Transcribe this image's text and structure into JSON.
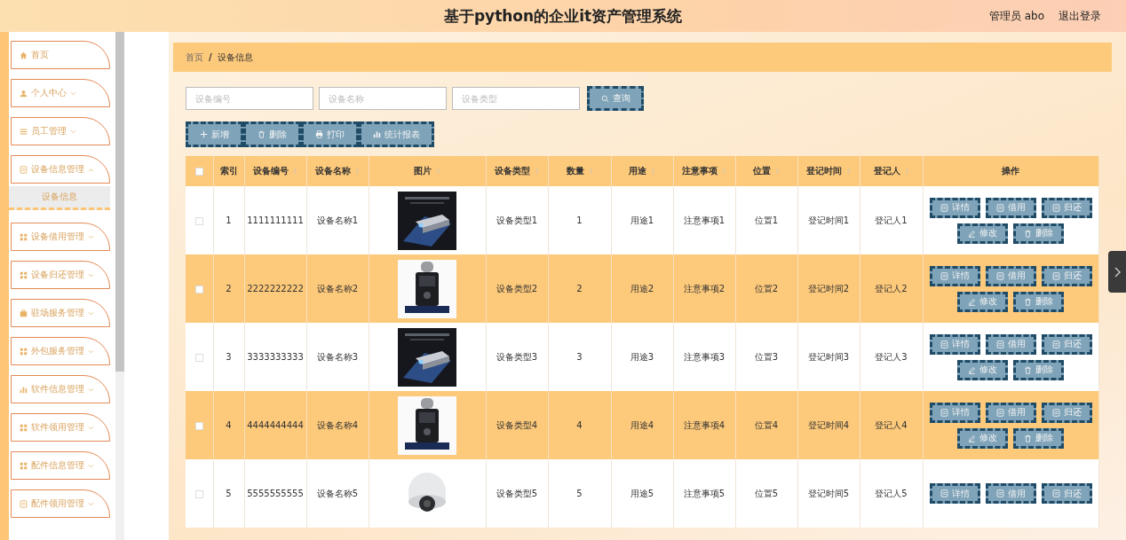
{
  "header": {
    "title": "基于python的企业it资产管理系统",
    "user": "管理员 abo",
    "logout": "退出登录"
  },
  "sidebar": {
    "items": [
      {
        "label": "首页",
        "kind": "link",
        "expanded": false
      },
      {
        "label": "个人中心",
        "kind": "menu",
        "expanded": false
      },
      {
        "label": "员工管理",
        "kind": "menu",
        "expanded": false
      },
      {
        "label": "设备信息管理",
        "kind": "menu",
        "expanded": true,
        "children": [
          {
            "label": "设备信息",
            "selected": true
          }
        ]
      },
      {
        "label": "设备借用管理",
        "kind": "menu",
        "expanded": false
      },
      {
        "label": "设备归还管理",
        "kind": "menu",
        "expanded": false
      },
      {
        "label": "驻场服务管理",
        "kind": "menu",
        "expanded": false
      },
      {
        "label": "外包服务管理",
        "kind": "menu",
        "expanded": false
      },
      {
        "label": "软件信息管理",
        "kind": "menu",
        "expanded": false
      },
      {
        "label": "软件领用管理",
        "kind": "menu",
        "expanded": false
      },
      {
        "label": "配件信息管理",
        "kind": "menu",
        "expanded": false
      },
      {
        "label": "配件领用管理",
        "kind": "menu",
        "expanded": false
      }
    ]
  },
  "breadcrumb": [
    {
      "label": "首页",
      "current": false
    },
    {
      "label": "设备信息",
      "current": true
    }
  ],
  "breadcrumb_separator": "/",
  "search": {
    "fields": [
      {
        "placeholder": "设备编号"
      },
      {
        "placeholder": "设备名称"
      },
      {
        "placeholder": "设备类型"
      }
    ],
    "button": "查询"
  },
  "toolbar": [
    "新增",
    "删除",
    "打印",
    "统计报表"
  ],
  "table": {
    "select_all_checked": false,
    "columns": [
      {
        "label": "索引",
        "sortable": false
      },
      {
        "label": "设备编号",
        "sortable": true
      },
      {
        "label": "设备名称",
        "sortable": true
      },
      {
        "label": "图片",
        "sortable": true
      },
      {
        "label": "设备类型",
        "sortable": true
      },
      {
        "label": "数量",
        "sortable": true
      },
      {
        "label": "用途",
        "sortable": true
      },
      {
        "label": "注意事项",
        "sortable": true
      },
      {
        "label": "位置",
        "sortable": true
      },
      {
        "label": "登记时间",
        "sortable": true
      },
      {
        "label": "登记人",
        "sortable": true
      },
      {
        "label": "操作",
        "sortable": false
      }
    ],
    "rows": [
      {
        "checked": false,
        "index": "1",
        "code": "1111111111",
        "name": "设备名称1",
        "image": {
          "kind": "picture"
        },
        "type": "设备类型1",
        "qty": "1",
        "use": "用途1",
        "notes": "注意事项1",
        "location": "位置1",
        "time": "登记时间1",
        "registrar": "登记人1",
        "actions": [
          "详情",
          "借用",
          "归还",
          "修改",
          "删除"
        ]
      },
      {
        "checked": false,
        "index": "2",
        "code": "2222222222",
        "name": "设备名称2",
        "image": {
          "kind": "picture"
        },
        "type": "设备类型2",
        "qty": "2",
        "use": "用途2",
        "notes": "注意事项2",
        "location": "位置2",
        "time": "登记时间2",
        "registrar": "登记人2",
        "actions": [
          "详情",
          "借用",
          "归还",
          "修改",
          "删除"
        ]
      },
      {
        "checked": false,
        "index": "3",
        "code": "3333333333",
        "name": "设备名称3",
        "image": {
          "kind": "picture"
        },
        "type": "设备类型3",
        "qty": "3",
        "use": "用途3",
        "notes": "注意事项3",
        "location": "位置3",
        "time": "登记时间3",
        "registrar": "登记人3",
        "actions": [
          "详情",
          "借用",
          "归还",
          "修改",
          "删除"
        ]
      },
      {
        "checked": false,
        "index": "4",
        "code": "4444444444",
        "name": "设备名称4",
        "image": {
          "kind": "picture"
        },
        "type": "设备类型4",
        "qty": "4",
        "use": "用途4",
        "notes": "注意事项4",
        "location": "位置4",
        "time": "登记时间4",
        "registrar": "登记人4",
        "actions": [
          "详情",
          "借用",
          "归还",
          "修改",
          "删除"
        ]
      },
      {
        "checked": false,
        "index": "5",
        "code": "5555555555",
        "name": "设备名称5",
        "image": {
          "kind": "picture"
        },
        "type": "设备类型5",
        "qty": "5",
        "use": "用途5",
        "notes": "注意事项5",
        "location": "位置5",
        "time": "登记时间5",
        "registrar": "登记人5",
        "actions": [
          "详情",
          "借用",
          "归还"
        ]
      }
    ]
  }
}
